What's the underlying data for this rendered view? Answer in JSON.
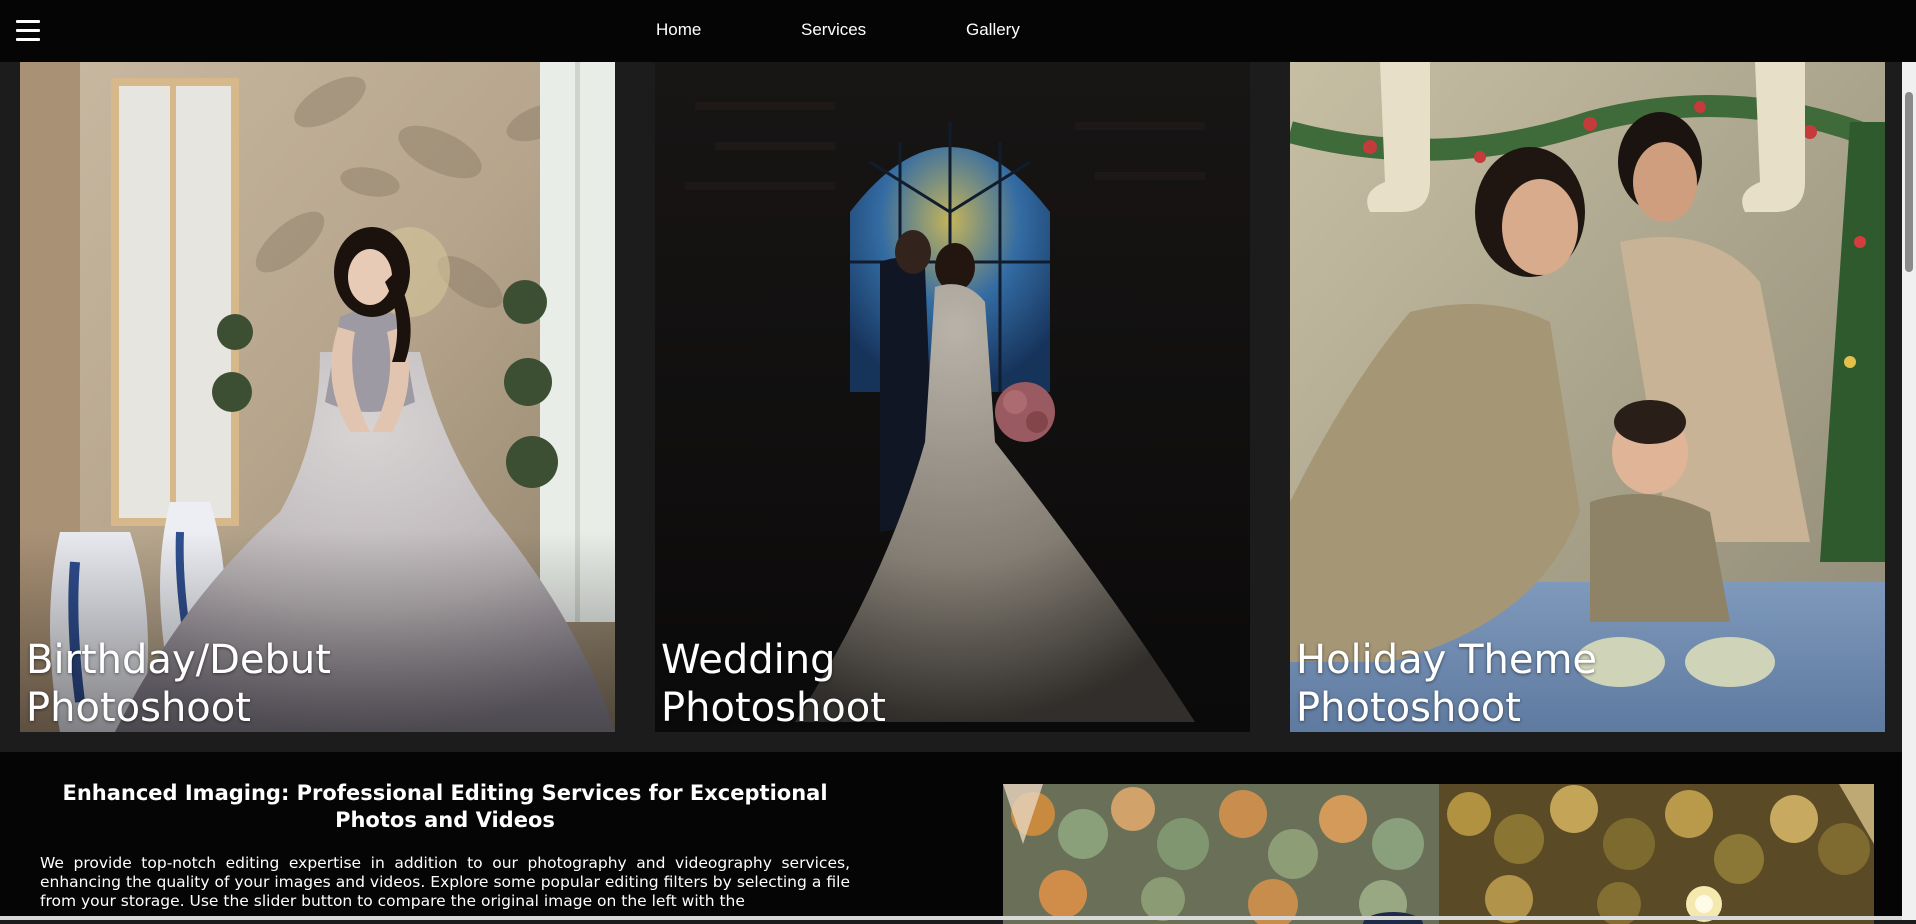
{
  "nav": {
    "menu_icon": "hamburger-menu-icon",
    "links": [
      "Home",
      "Services",
      "Gallery"
    ]
  },
  "gallery": {
    "cards": [
      {
        "title": "Birthday/Debut\nPhotoshoot"
      },
      {
        "title": "Wedding\nPhotoshoot"
      },
      {
        "title": "Holiday Theme\nPhotoshoot"
      }
    ]
  },
  "editing": {
    "heading": "Enhanced Imaging: Professional Editing Services for Exceptional Photos and Videos",
    "body": "We provide top-notch editing expertise in addition to our photography and videography services, enhancing the quality of your images and videos. Explore some popular editing filters by selecting a file from your storage. Use the slider button to compare the original image on the left with the"
  },
  "colors": {
    "nav_bg": "#050505",
    "page_bg": "#1c1c1c",
    "text": "#ffffff"
  }
}
